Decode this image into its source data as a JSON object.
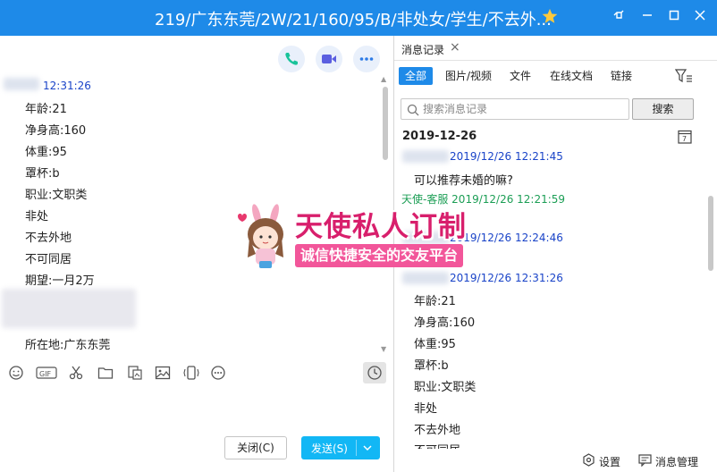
{
  "window": {
    "title": "219/广东东莞/2W/21/160/95/B/非处女/学生/不去外...",
    "colors": {
      "titlebar": "#1e8ae8",
      "timestamp": "#1a44c8",
      "service": "#1c9e55",
      "send": "#12b7f5"
    }
  },
  "chat": {
    "timestamp": "12:31:26",
    "lines": [
      "年龄:21",
      "净身高:160",
      "体重:95",
      "罩杯:b",
      "职业:文职类",
      "非处",
      "不去外地",
      "不可同居",
      "期望:一月2万",
      "所在地:广东东莞"
    ],
    "close_label": "关闭(C)",
    "send_label": "发送(S)",
    "toolbar_icons": [
      "emoji-icon",
      "gif-icon",
      "scissors-icon",
      "folder-icon",
      "image-text-icon",
      "image-icon",
      "vibrate-icon",
      "more-icon",
      "history-icon"
    ]
  },
  "history": {
    "tab_label": "消息记录",
    "filters": [
      "全部",
      "图片/视频",
      "文件",
      "在线文档",
      "链接"
    ],
    "search_placeholder": "搜索消息记录",
    "search_button": "搜索",
    "date": "2019-12-26",
    "messages": [
      {
        "ts": "2019/12/26 12:21:45",
        "text": "可以推荐未婚的嘛?"
      },
      {
        "sender": "天使-客服",
        "ts": "2019/12/26 12:21:59"
      },
      {
        "ts": "2019/12/26 12:24:46"
      },
      {
        "ts": "2019/12/26 12:31:26"
      }
    ],
    "lines": [
      "年龄:21",
      "净身高:160",
      "体重:95",
      "罩杯:b",
      "职业:文职类",
      "非处",
      "不去外地",
      "不可同居"
    ],
    "settings_label": "设置",
    "manage_label": "消息管理"
  },
  "watermark": {
    "line1": "天使私人订制",
    "line2": "诚信快捷安全的交友平台"
  }
}
